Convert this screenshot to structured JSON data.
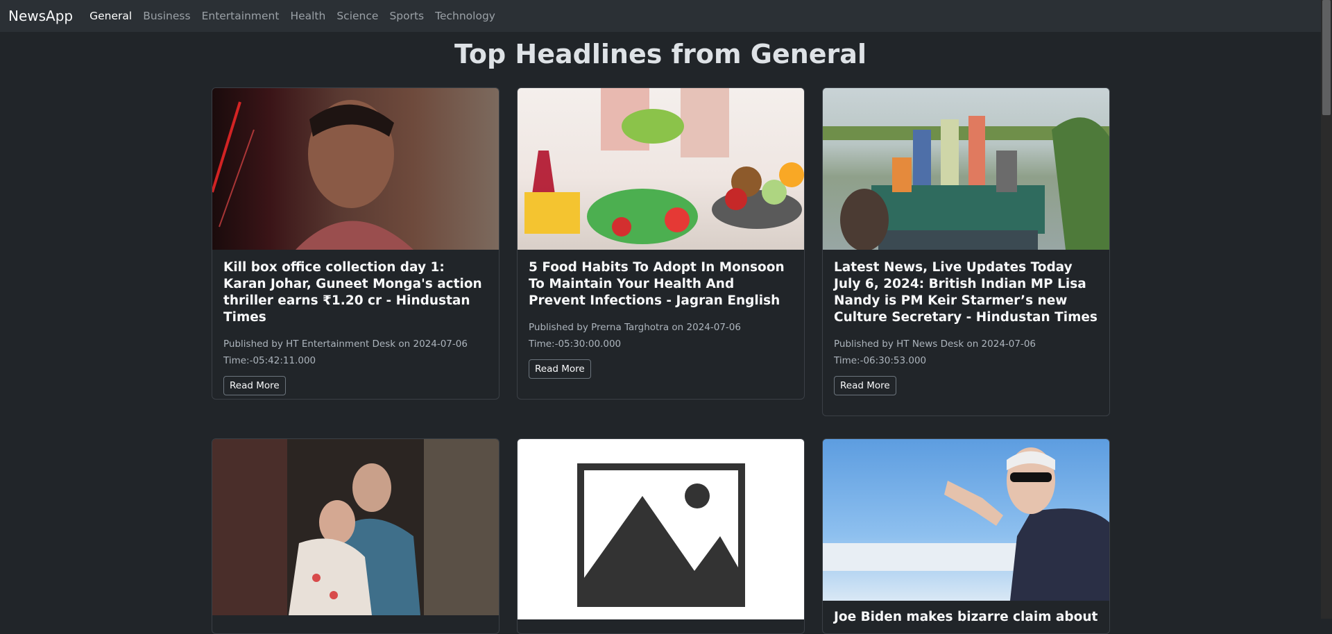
{
  "nav": {
    "brand": "NewsApp",
    "links": [
      "General",
      "Business",
      "Entertainment",
      "Health",
      "Science",
      "Sports",
      "Technology"
    ]
  },
  "page_title": "Top Headlines from General",
  "cards": [
    {
      "title": "Kill box office collection day 1: Karan Johar, Guneet Monga's action thriller earns ₹1.20 cr - Hindustan Times",
      "published": "Published by HT Entertainment Desk on 2024-07-06",
      "time": "Time:-05:42:11.000",
      "button": "Read More"
    },
    {
      "title": "5 Food Habits To Adopt In Monsoon To Maintain Your Health And Prevent Infections - Jagran English",
      "published": "Published by Prerna Targhotra on 2024-07-06",
      "time": "Time:-05:30:00.000",
      "button": "Read More"
    },
    {
      "title": "Latest News, Live Updates Today July 6, 2024: British Indian MP Lisa Nandy is PM Keir Starmer’s new Culture Secretary - Hindustan Times",
      "published": "Published by HT News Desk on 2024-07-06",
      "time": "Time:-06:30:53.000",
      "button": "Read More"
    },
    {
      "title": "Joe Biden makes bizarre claim about"
    }
  ],
  "colors": {
    "page_bg": "#212529",
    "navbar_bg": "#2b3035",
    "card_border": "#3b4046"
  }
}
